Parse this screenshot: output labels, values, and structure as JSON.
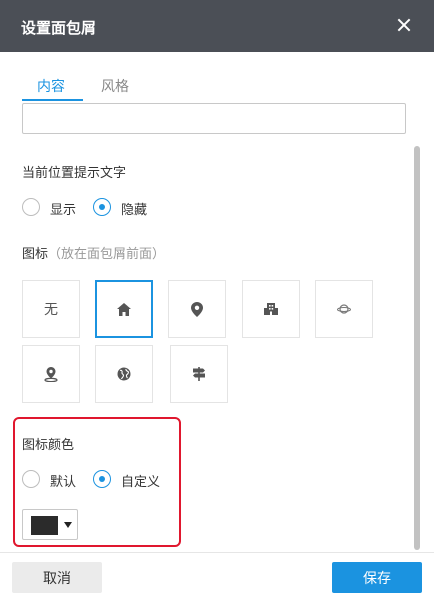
{
  "dialog": {
    "title": "设置面包屑"
  },
  "tabs": [
    {
      "label": "内容",
      "active": true
    },
    {
      "label": "风格",
      "active": false
    }
  ],
  "content": {
    "top_input_value": "",
    "position_hint": {
      "label": "当前位置提示文字",
      "options": [
        {
          "label": "显示",
          "checked": false
        },
        {
          "label": "隐藏",
          "checked": true
        }
      ]
    },
    "icon_section": {
      "label": "图标",
      "hint": "（放在面包屑前面）",
      "icons": [
        {
          "name": "none",
          "text": "无",
          "selected": false
        },
        {
          "name": "home-icon",
          "selected": true
        },
        {
          "name": "location-pin-icon",
          "selected": false
        },
        {
          "name": "building-icon",
          "selected": false
        },
        {
          "name": "planet-icon",
          "selected": false
        },
        {
          "name": "map-marker-icon",
          "selected": false
        },
        {
          "name": "globe-icon",
          "selected": false
        },
        {
          "name": "signpost-icon",
          "selected": false
        }
      ]
    },
    "icon_color": {
      "label": "图标颜色",
      "options": [
        {
          "label": "默认",
          "checked": false
        },
        {
          "label": "自定义",
          "checked": true
        }
      ],
      "selected_color": "#2b2b2b"
    }
  },
  "footer": {
    "cancel_label": "取消",
    "save_label": "保存"
  },
  "colors": {
    "accent": "#1b93e0",
    "titlebar": "#4b4f56",
    "highlight": "#e0172e"
  }
}
